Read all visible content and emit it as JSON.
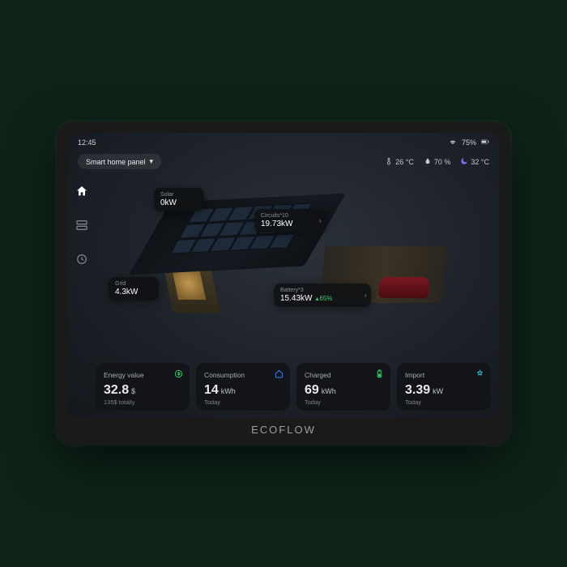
{
  "brand": "ECOFLOW",
  "statusbar": {
    "time": "12:45",
    "battery": "75%"
  },
  "header": {
    "panel_label": "Smart home panel",
    "env": {
      "temp_in": "26 °C",
      "humidity": "70 %",
      "temp_out": "32 °C"
    }
  },
  "callouts": {
    "solar": {
      "label": "Solar",
      "value": "0kW"
    },
    "circuits": {
      "label": "Circuits*10",
      "value": "19.73kW"
    },
    "grid": {
      "label": "Grid",
      "value": "4.3kW"
    },
    "battery": {
      "label": "Battery*3",
      "value": "15.43kW",
      "delta": "65%"
    }
  },
  "cards": [
    {
      "title": "Energy value",
      "value": "32.8",
      "unit": "$",
      "sub": "135$ totally",
      "icon": "currency-icon",
      "icon_color": "c-green"
    },
    {
      "title": "Consumption",
      "value": "14",
      "unit": "kWh",
      "sub": "Today",
      "icon": "home-icon",
      "icon_color": "c-blue"
    },
    {
      "title": "Charged",
      "value": "69",
      "unit": "kWh",
      "sub": "Today",
      "icon": "battery-icon",
      "icon_color": "c-batt"
    },
    {
      "title": "Import",
      "value": "3.39",
      "unit": "kW",
      "sub": "Today",
      "icon": "star-person-icon",
      "icon_color": "c-cyan"
    }
  ]
}
